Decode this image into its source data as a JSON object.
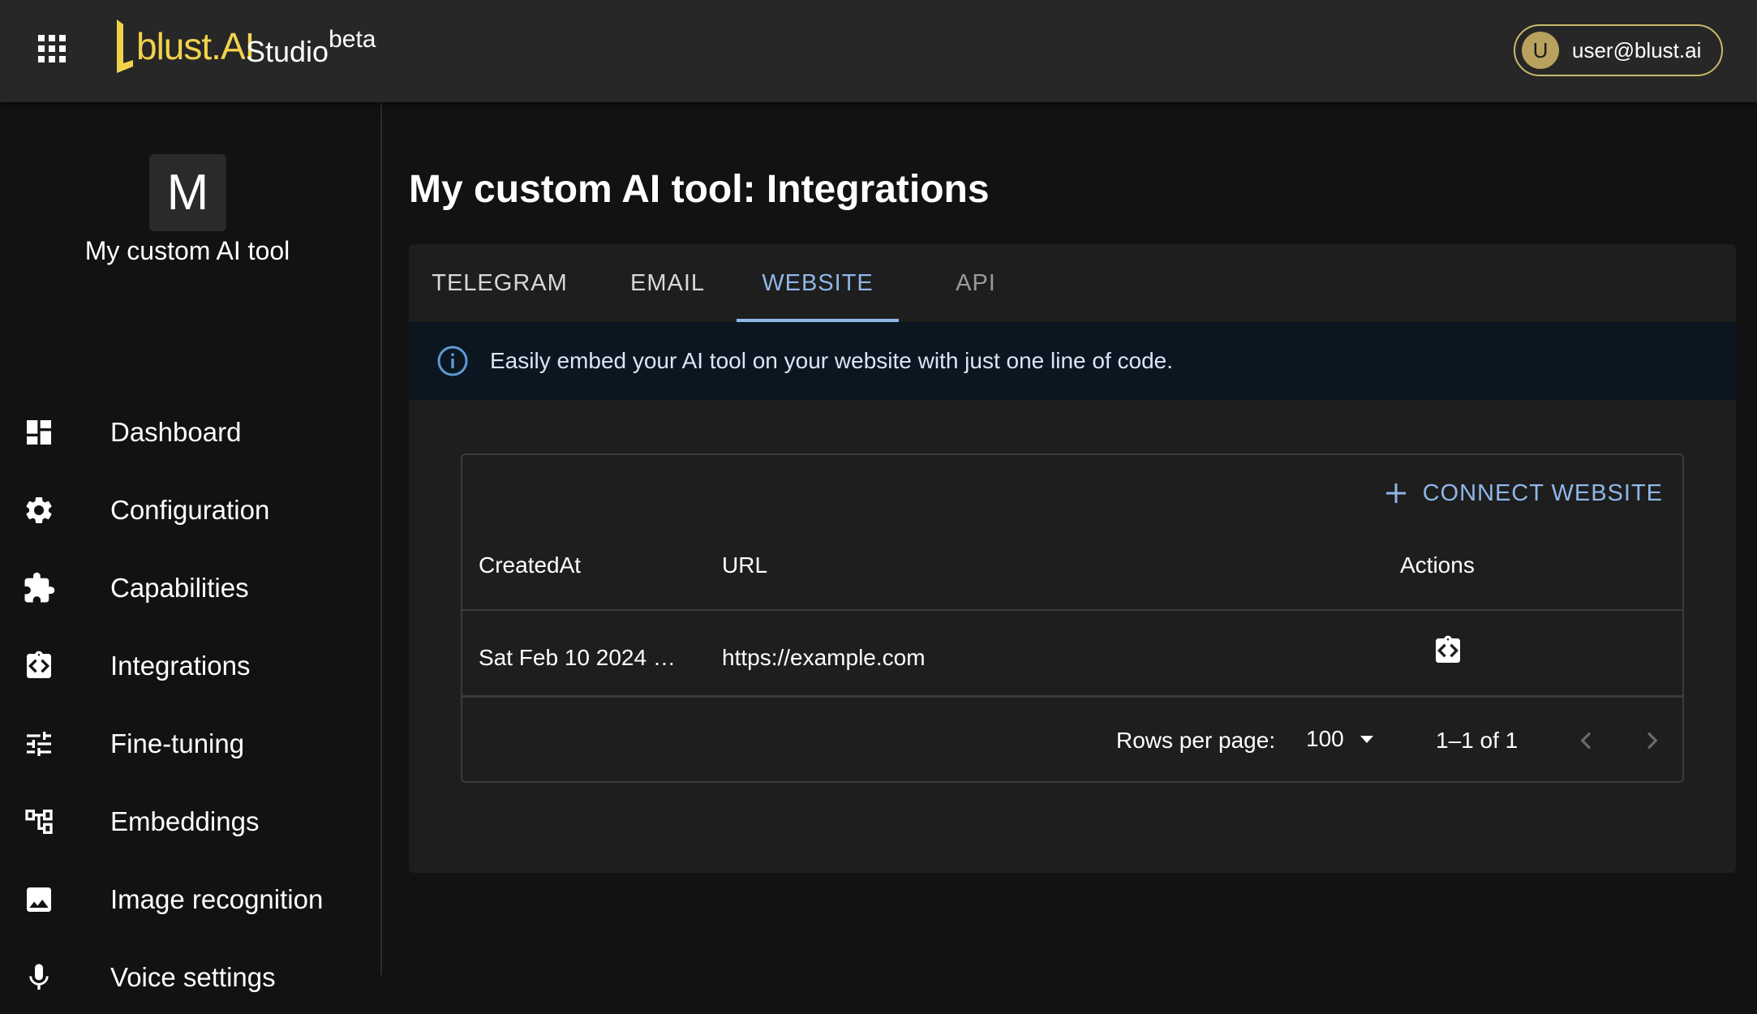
{
  "header": {
    "logo_text": "blust.AI",
    "product_name": "Studio",
    "product_badge": "beta",
    "user": {
      "avatar_initial": "U",
      "email": "user@blust.ai"
    }
  },
  "sidebar": {
    "tool_avatar_letter": "M",
    "tool_name": "My custom AI tool",
    "items": [
      {
        "label": "Dashboard",
        "icon": "dashboard-icon"
      },
      {
        "label": "Configuration",
        "icon": "gear-icon"
      },
      {
        "label": "Capabilities",
        "icon": "puzzle-icon"
      },
      {
        "label": "Integrations",
        "icon": "integration-icon"
      },
      {
        "label": "Fine-tuning",
        "icon": "tune-icon"
      },
      {
        "label": "Embeddings",
        "icon": "embeddings-icon"
      },
      {
        "label": "Image recognition",
        "icon": "image-icon"
      },
      {
        "label": "Voice settings",
        "icon": "microphone-icon"
      }
    ]
  },
  "main": {
    "title": "My custom AI tool: Integrations",
    "tabs": [
      {
        "label": "TELEGRAM"
      },
      {
        "label": "EMAIL"
      },
      {
        "label": "WEBSITE"
      },
      {
        "label": "API"
      }
    ],
    "active_tab": "WEBSITE",
    "info_message": "Easily embed your AI tool on your website with just one line of code.",
    "grid": {
      "connect_button": "CONNECT WEBSITE",
      "columns": [
        "CreatedAt",
        "URL",
        "Actions"
      ],
      "rows": [
        {
          "created_at": "Sat Feb 10 2024 …",
          "url": "https://example.com",
          "action_icon": "embed-code-icon"
        }
      ],
      "footer": {
        "rows_per_page_label": "Rows per page:",
        "rows_per_page_value": "100",
        "range_text": "1–1 of 1"
      }
    }
  },
  "colors": {
    "accent_blue": "#8fb7e8",
    "logo_yellow": "#f2d24b",
    "user_chip_border": "#c8b96a",
    "top_bar": "#272727",
    "background": "#121212",
    "panel": "#1e1e1e",
    "info_banner": "#0c1620"
  }
}
